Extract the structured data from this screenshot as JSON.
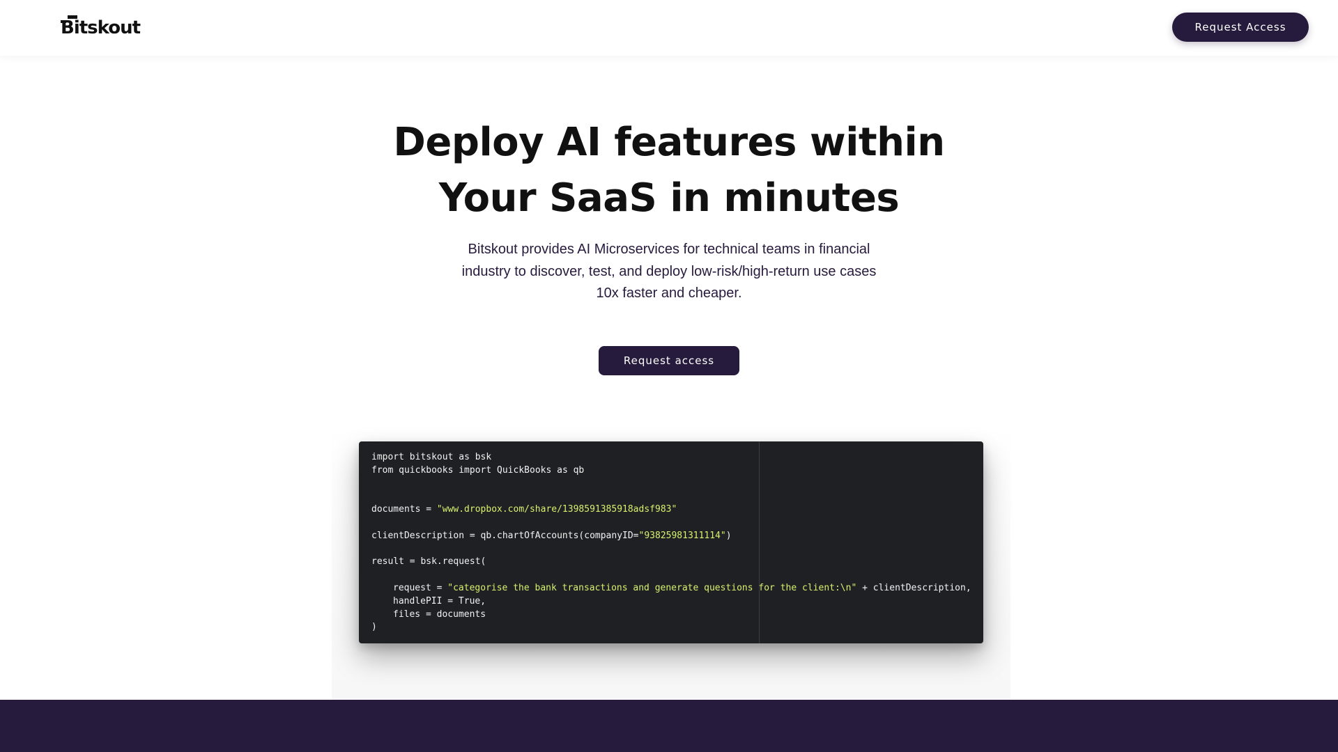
{
  "nav": {
    "logo_text": "Bitskout",
    "request_access_label": "Request Access"
  },
  "hero": {
    "title_line1": "Deploy AI features within",
    "title_line2": "Your SaaS in minutes",
    "subtitle_line1": "Bitskout provides AI Microservices for technical teams in financial",
    "subtitle_line2": "industry to discover, test, and deploy low-risk/high-return use cases",
    "subtitle_line3": "10x faster and cheaper.",
    "cta_label": "Request access"
  },
  "code": {
    "l1_kw1": "import",
    "l1_rest": " bitskout ",
    "l1_kw2": "as",
    "l1_end": " bsk",
    "l2_kw1": "from",
    "l2_mid": " quickbooks ",
    "l2_kw2": "import",
    "l2_mid2": " QuickBooks ",
    "l2_kw3": "as",
    "l2_end": " qb",
    "l3_pre": "documents = ",
    "l3_str": "\"www.dropbox.com/share/1398591385918adsf983\"",
    "l4_pre": "clientDescription = qb.chartOfAccounts(companyID=",
    "l4_str": "\"93825981311114\"",
    "l4_end": ")",
    "l5": "result = bsk.request(",
    "l6_pre": "request = ",
    "l6_str": "\"categorise the bank transactions and generate questions for the client:\\n\"",
    "l6_end": " + clientDescription,",
    "l7": "handlePII = True,",
    "l8": "files = documents",
    "l9": ")"
  }
}
